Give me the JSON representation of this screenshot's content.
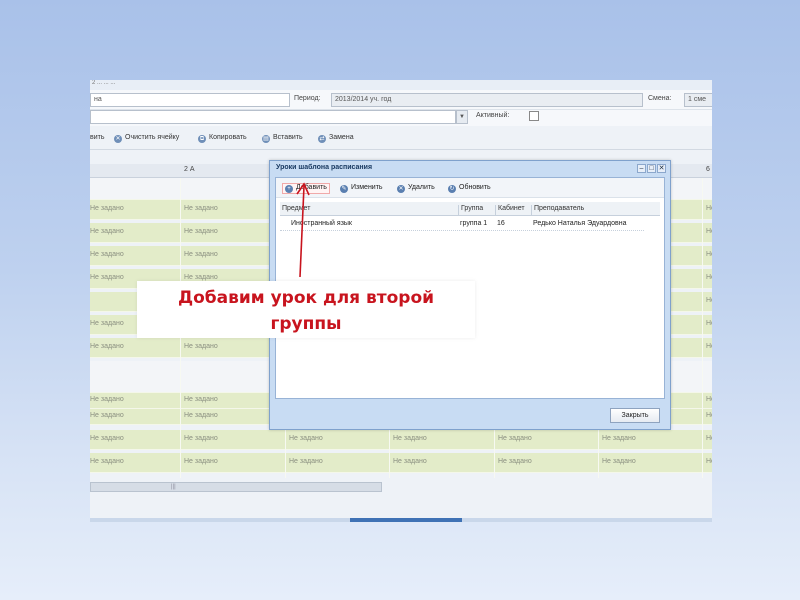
{
  "background": {
    "truncated_caption": "2 ... ... ..."
  },
  "form": {
    "name_value": "на",
    "period_label": "Период:",
    "period_value": "2013/2014 уч. год",
    "shift_label": "Смена:",
    "shift_value": "1 сме",
    "active_label": "Активный:"
  },
  "toolbar": {
    "add_partial": "вить",
    "clear_cell": "Очистить ячейку",
    "copy": "Копировать",
    "paste": "Вставить",
    "replace": "Замена"
  },
  "grid": {
    "col_2a": "2 А",
    "col_right": "6",
    "placeholder": "Не задано",
    "right_partial": "Не"
  },
  "dialog": {
    "title": "Уроки шаблона расписания",
    "toolbar": {
      "add": "Добавить",
      "edit": "Изменить",
      "delete": "Удалить",
      "refresh": "Обновить"
    },
    "columns": [
      "Предмет",
      "Группа",
      "Кабинет",
      "Преподаватель"
    ],
    "rows": [
      {
        "subject": "Иностранный язык",
        "group": "группа 1",
        "room": "16",
        "teacher": "Редько Наталья Эдуардовна"
      }
    ],
    "close_label": "Закрыть"
  },
  "callout": {
    "line1": "Добавим урок для второй",
    "line2": "группы",
    "color": "#c8141e"
  }
}
